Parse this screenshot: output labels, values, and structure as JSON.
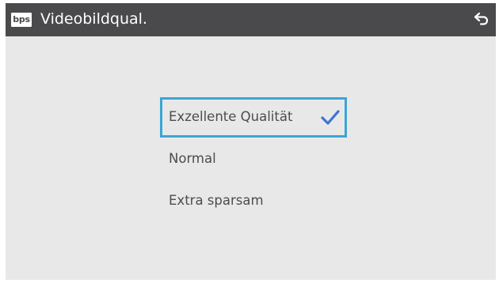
{
  "header": {
    "logo_text": "bps",
    "title": "Videobildqual.",
    "back_icon": "back-arrow-icon"
  },
  "options": [
    {
      "label": "Exzellente Qualität",
      "selected": true
    },
    {
      "label": "Normal",
      "selected": false
    },
    {
      "label": "Extra sparsam",
      "selected": false
    }
  ],
  "colors": {
    "header_bg": "#4a4a4c",
    "screen_bg": "#e9e8e9",
    "selection_border": "#3aa6d4",
    "check_mark": "#3f74cf",
    "text": "#4c4c4c"
  }
}
